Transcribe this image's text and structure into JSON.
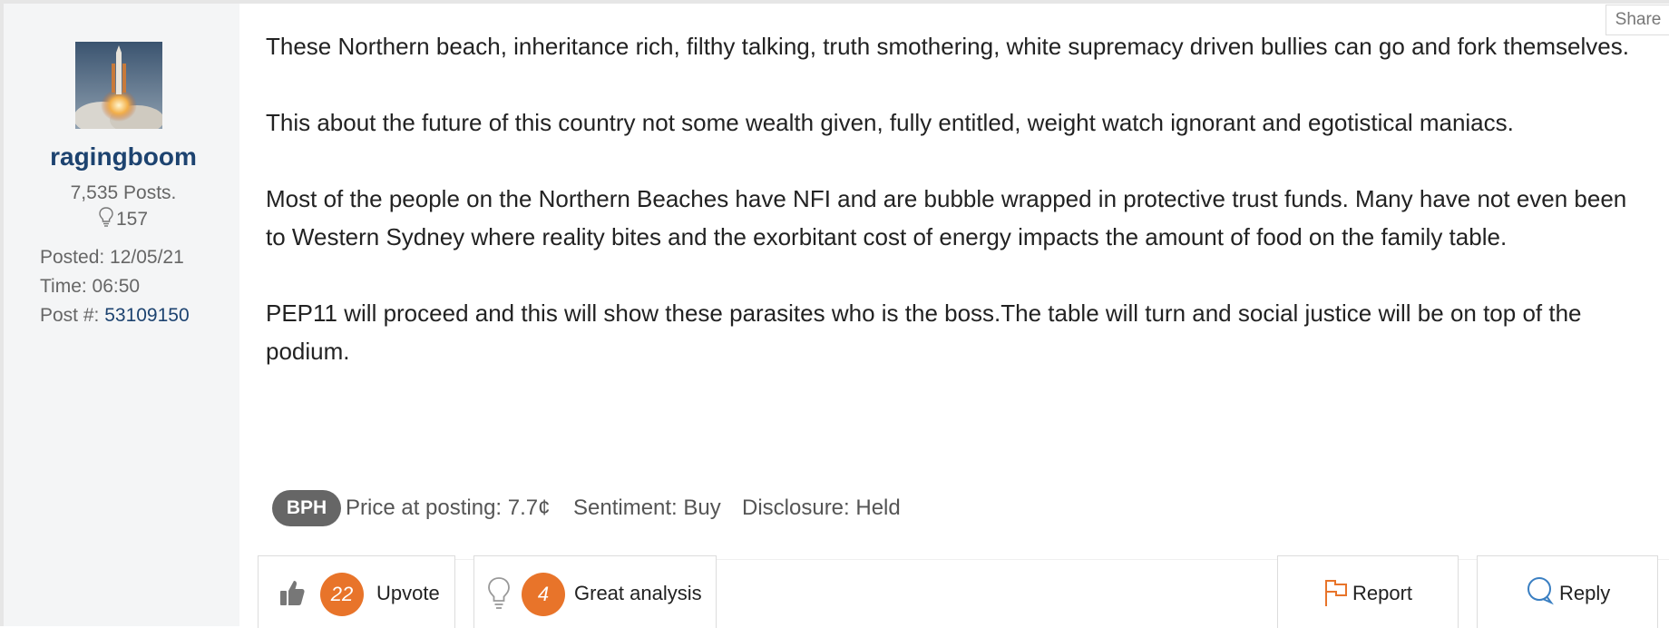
{
  "author": {
    "username": "ragingboom",
    "posts": "7,535 Posts.",
    "likes": "157",
    "posted": "Posted: 12/05/21",
    "time": "Time: 06:50",
    "post_num_label": "Post #:",
    "post_num": "53109150"
  },
  "share_label": "Share",
  "post": {
    "paragraphs": [
      "These Northern beach, inheritance rich, filthy talking, truth smothering, white supremacy driven bullies can go and fork themselves.",
      "This about the future of this country not some wealth given, fully entitled, weight watch ignorant and egotistical maniacs.",
      "Most of the people on the Northern Beaches have NFI and are bubble wrapped in protective trust funds. Many have not even been to Western Sydney where reality bites and the exorbitant cost of energy impacts the amount of food on the family table.",
      "PEP11 will proceed and this will show these parasites who is the boss.The table will turn and social justice will be on top of the podium."
    ]
  },
  "tags": {
    "ticker": "BPH",
    "price": "Price at posting: 7.7¢",
    "sentiment": "Sentiment: Buy",
    "disclosure": "Disclosure: Held"
  },
  "actions": {
    "upvote_count": "22",
    "upvote_label": "Upvote",
    "analysis_count": "4",
    "analysis_label": "Great analysis",
    "report_label": "Report",
    "reply_label": "Reply"
  },
  "colors": {
    "accent": "#e8742a",
    "link": "#1d4370",
    "pill": "#666666"
  },
  "icons": [
    "lightbulb-icon",
    "thumbs-up-icon",
    "flag-icon",
    "speech-bubble-icon"
  ]
}
